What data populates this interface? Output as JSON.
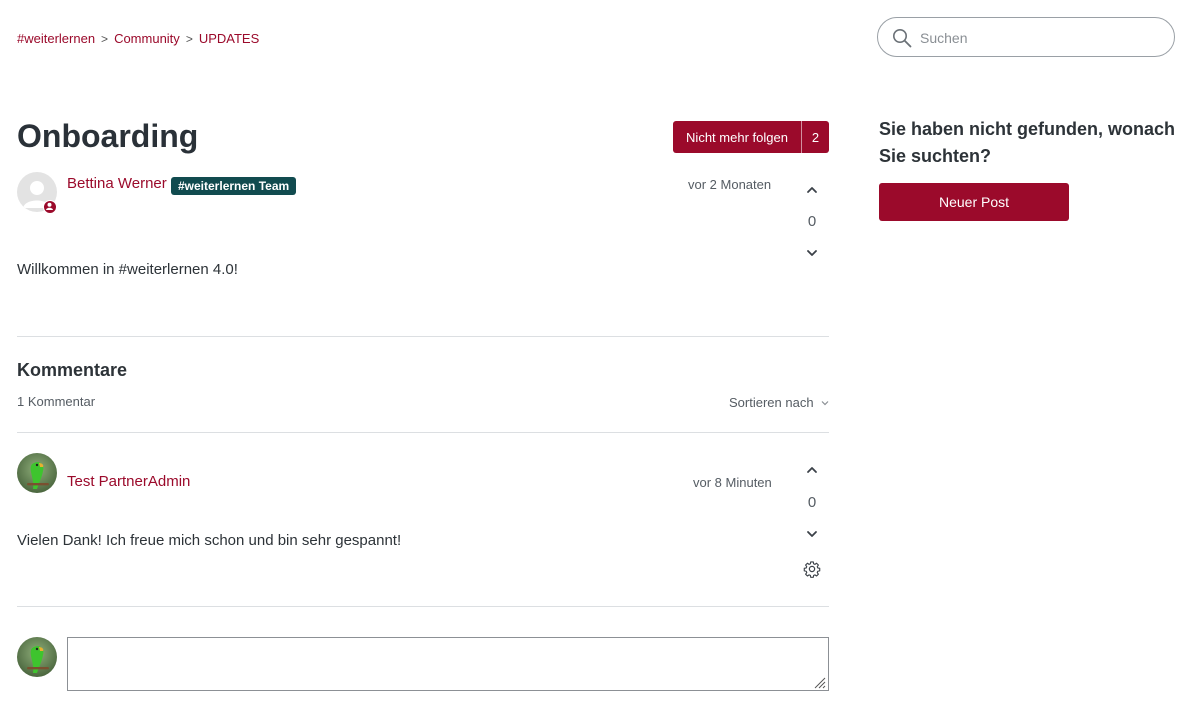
{
  "breadcrumb": [
    {
      "label": "#weiterlernen"
    },
    {
      "label": "Community"
    },
    {
      "label": "UPDATES"
    }
  ],
  "breadcrumb_separator": ">",
  "search": {
    "placeholder": "Suchen",
    "value": ""
  },
  "post": {
    "title": "Onboarding",
    "follow_label": "Nicht mehr folgen",
    "follower_count": "2",
    "author": "Bettina Werner",
    "author_badge": "#weiterlernen Team",
    "time": "vor 2 Monaten",
    "votes": "0",
    "body": "Willkommen in #weiterlernen 4.0!"
  },
  "comments": {
    "title": "Kommentare",
    "count_label": "1 Kommentar",
    "sort_label": "Sortieren nach",
    "items": [
      {
        "author": "Test PartnerAdmin",
        "time": "vor 8 Minuten",
        "votes": "0",
        "body": "Vielen Dank! Ich freue mich schon und bin sehr gespannt!"
      }
    ]
  },
  "reply": {
    "value": ""
  },
  "sidebar": {
    "title": "Sie haben nicht gefunden, wonach Sie suchten?",
    "new_post_label": "Neuer Post"
  },
  "colors": {
    "accent": "#9b0a2b",
    "team_badge": "#114b4f",
    "text": "#2d3338",
    "divider": "#dcdfe2"
  },
  "icons": [
    "search-icon",
    "chevron-up-icon",
    "chevron-down-icon",
    "gear-icon",
    "user-badge-icon",
    "resize-handle-icon"
  ]
}
